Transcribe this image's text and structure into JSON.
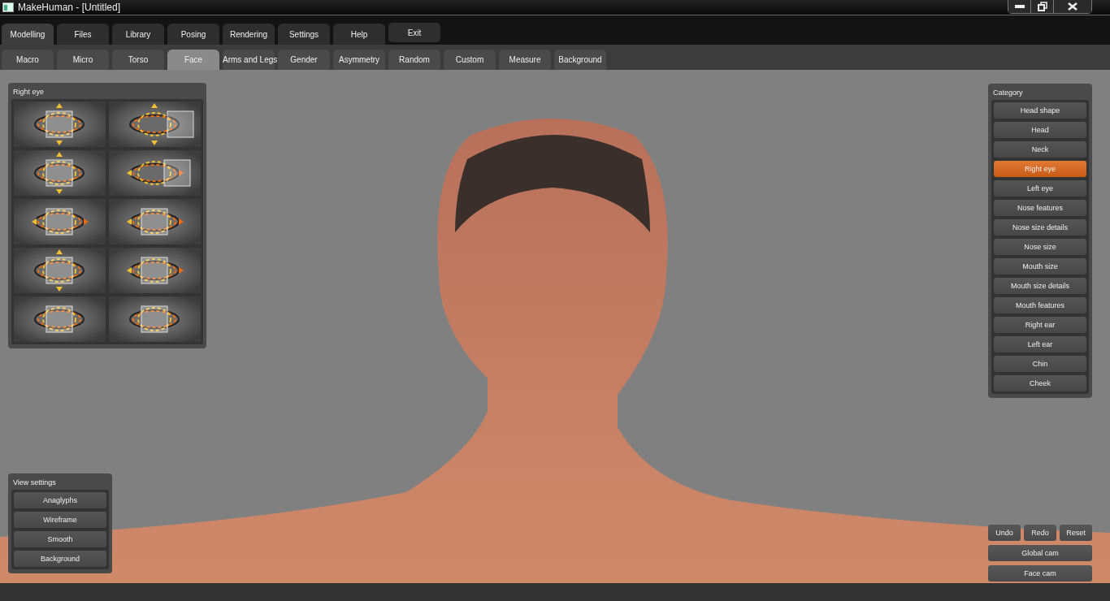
{
  "window": {
    "title": "MakeHuman - [Untitled]"
  },
  "main_tabs": [
    {
      "label": "Modelling",
      "selected": true
    },
    {
      "label": "Files",
      "selected": false
    },
    {
      "label": "Library",
      "selected": false
    },
    {
      "label": "Posing",
      "selected": false
    },
    {
      "label": "Rendering",
      "selected": false
    },
    {
      "label": "Settings",
      "selected": false
    },
    {
      "label": "Help",
      "selected": false
    }
  ],
  "exit_button": "Exit",
  "sub_tabs": [
    {
      "label": "Macro",
      "selected": false
    },
    {
      "label": "Micro",
      "selected": false
    },
    {
      "label": "Torso",
      "selected": false
    },
    {
      "label": "Face",
      "selected": true
    },
    {
      "label": "Arms and Legs",
      "selected": false
    },
    {
      "label": "Gender",
      "selected": false
    },
    {
      "label": "Asymmetry",
      "selected": false
    },
    {
      "label": "Random",
      "selected": false
    },
    {
      "label": "Custom",
      "selected": false
    },
    {
      "label": "Measure",
      "selected": false
    },
    {
      "label": "Background",
      "selected": false
    }
  ],
  "modifier_panel": {
    "title": "Right eye"
  },
  "category_panel": {
    "title": "Category",
    "items": [
      {
        "label": "Head shape",
        "selected": false
      },
      {
        "label": "Head",
        "selected": false
      },
      {
        "label": "Neck",
        "selected": false
      },
      {
        "label": "Right eye",
        "selected": true
      },
      {
        "label": "Left eye",
        "selected": false
      },
      {
        "label": "Nose features",
        "selected": false
      },
      {
        "label": "Nose size details",
        "selected": false
      },
      {
        "label": "Nose size",
        "selected": false
      },
      {
        "label": "Mouth size",
        "selected": false
      },
      {
        "label": "Mouth size details",
        "selected": false
      },
      {
        "label": "Mouth features",
        "selected": false
      },
      {
        "label": "Right ear",
        "selected": false
      },
      {
        "label": "Left ear",
        "selected": false
      },
      {
        "label": "Chin",
        "selected": false
      },
      {
        "label": "Cheek",
        "selected": false
      }
    ]
  },
  "view_settings": {
    "title": "View settings",
    "buttons": [
      "Anaglyphs",
      "Wireframe",
      "Smooth",
      "Background"
    ]
  },
  "camera_controls": {
    "history_buttons": [
      "Undo",
      "Redo",
      "Reset"
    ],
    "camera_buttons": [
      "Global cam",
      "Face cam"
    ]
  }
}
